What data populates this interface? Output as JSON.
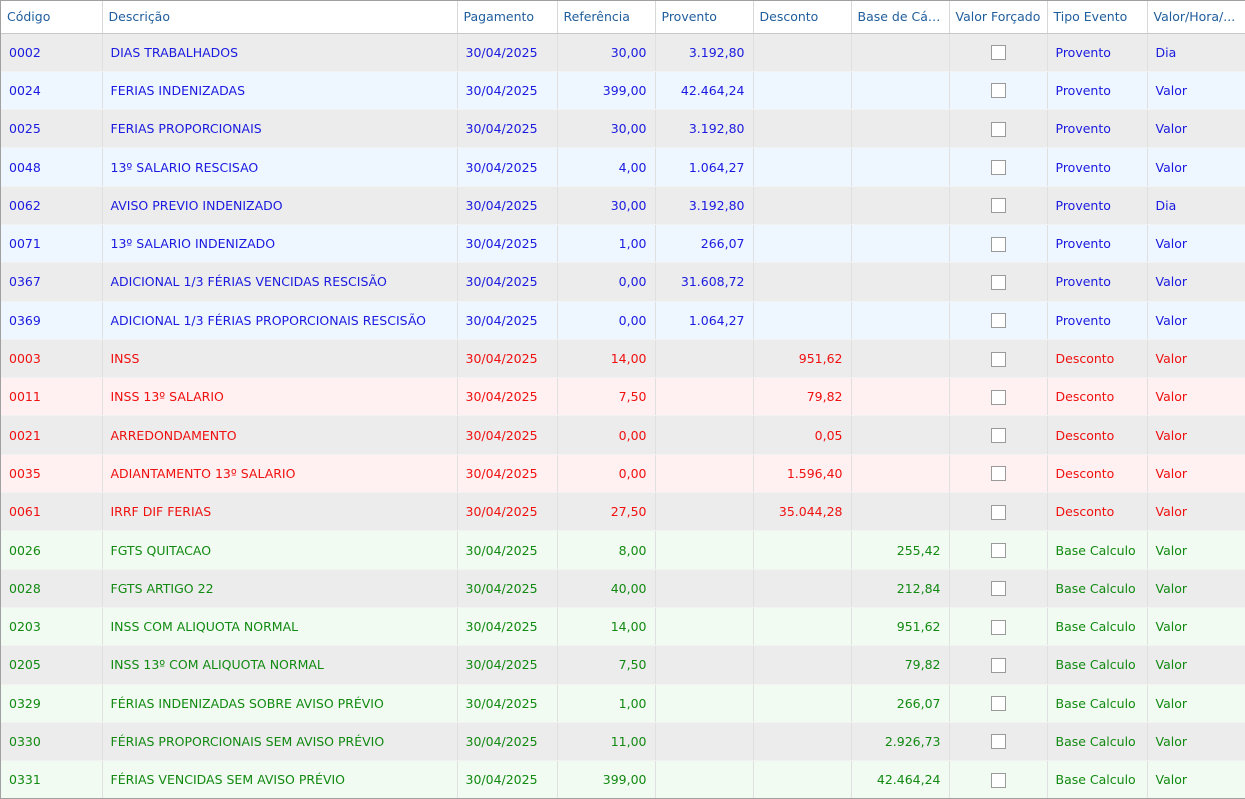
{
  "columns": {
    "codigo": "Código",
    "descricao": "Descrição",
    "pagamento": "Pagamento",
    "referencia": "Referência",
    "provento": "Provento",
    "desconto": "Desconto",
    "base": "Base de Cálc...",
    "forcado": "Valor Forçado",
    "tipo": "Tipo Evento",
    "vhd": "Valor/Hora/..."
  },
  "rows": [
    {
      "codigo": "0002",
      "descricao": "DIAS TRABALHADOS",
      "pagamento": "30/04/2025",
      "referencia": "30,00",
      "provento": "3.192,80",
      "desconto": "",
      "base": "",
      "forcado": false,
      "tipo": "Provento",
      "vhd": "Dia"
    },
    {
      "codigo": "0024",
      "descricao": "FERIAS INDENIZADAS",
      "pagamento": "30/04/2025",
      "referencia": "399,00",
      "provento": "42.464,24",
      "desconto": "",
      "base": "",
      "forcado": false,
      "tipo": "Provento",
      "vhd": "Valor"
    },
    {
      "codigo": "0025",
      "descricao": "FERIAS PROPORCIONAIS",
      "pagamento": "30/04/2025",
      "referencia": "30,00",
      "provento": "3.192,80",
      "desconto": "",
      "base": "",
      "forcado": false,
      "tipo": "Provento",
      "vhd": "Valor"
    },
    {
      "codigo": "0048",
      "descricao": "13º SALARIO RESCISAO",
      "pagamento": "30/04/2025",
      "referencia": "4,00",
      "provento": "1.064,27",
      "desconto": "",
      "base": "",
      "forcado": false,
      "tipo": "Provento",
      "vhd": "Valor"
    },
    {
      "codigo": "0062",
      "descricao": "AVISO PREVIO INDENIZADO",
      "pagamento": "30/04/2025",
      "referencia": "30,00",
      "provento": "3.192,80",
      "desconto": "",
      "base": "",
      "forcado": false,
      "tipo": "Provento",
      "vhd": "Dia"
    },
    {
      "codigo": "0071",
      "descricao": "13º SALARIO INDENIZADO",
      "pagamento": "30/04/2025",
      "referencia": "1,00",
      "provento": "266,07",
      "desconto": "",
      "base": "",
      "forcado": false,
      "tipo": "Provento",
      "vhd": "Valor"
    },
    {
      "codigo": "0367",
      "descricao": "ADICIONAL 1/3 FÉRIAS VENCIDAS RESCISÃO",
      "pagamento": "30/04/2025",
      "referencia": "0,00",
      "provento": "31.608,72",
      "desconto": "",
      "base": "",
      "forcado": false,
      "tipo": "Provento",
      "vhd": "Valor"
    },
    {
      "codigo": "0369",
      "descricao": "ADICIONAL 1/3 FÉRIAS PROPORCIONAIS RESCISÃO",
      "pagamento": "30/04/2025",
      "referencia": "0,00",
      "provento": "1.064,27",
      "desconto": "",
      "base": "",
      "forcado": false,
      "tipo": "Provento",
      "vhd": "Valor"
    },
    {
      "codigo": "0003",
      "descricao": "INSS",
      "pagamento": "30/04/2025",
      "referencia": "14,00",
      "provento": "",
      "desconto": "951,62",
      "base": "",
      "forcado": false,
      "tipo": "Desconto",
      "vhd": "Valor"
    },
    {
      "codigo": "0011",
      "descricao": "INSS 13º SALARIO",
      "pagamento": "30/04/2025",
      "referencia": "7,50",
      "provento": "",
      "desconto": "79,82",
      "base": "",
      "forcado": false,
      "tipo": "Desconto",
      "vhd": "Valor"
    },
    {
      "codigo": "0021",
      "descricao": "ARREDONDAMENTO",
      "pagamento": "30/04/2025",
      "referencia": "0,00",
      "provento": "",
      "desconto": "0,05",
      "base": "",
      "forcado": false,
      "tipo": "Desconto",
      "vhd": "Valor"
    },
    {
      "codigo": "0035",
      "descricao": "ADIANTAMENTO 13º SALARIO",
      "pagamento": "30/04/2025",
      "referencia": "0,00",
      "provento": "",
      "desconto": "1.596,40",
      "base": "",
      "forcado": false,
      "tipo": "Desconto",
      "vhd": "Valor"
    },
    {
      "codigo": "0061",
      "descricao": "IRRF DIF FERIAS",
      "pagamento": "30/04/2025",
      "referencia": "27,50",
      "provento": "",
      "desconto": "35.044,28",
      "base": "",
      "forcado": false,
      "tipo": "Desconto",
      "vhd": "Valor"
    },
    {
      "codigo": "0026",
      "descricao": "FGTS QUITACAO",
      "pagamento": "30/04/2025",
      "referencia": "8,00",
      "provento": "",
      "desconto": "",
      "base": "255,42",
      "forcado": false,
      "tipo": "Base Calculo",
      "vhd": "Valor"
    },
    {
      "codigo": "0028",
      "descricao": "FGTS ARTIGO 22",
      "pagamento": "30/04/2025",
      "referencia": "40,00",
      "provento": "",
      "desconto": "",
      "base": "212,84",
      "forcado": false,
      "tipo": "Base Calculo",
      "vhd": "Valor"
    },
    {
      "codigo": "0203",
      "descricao": "INSS COM ALIQUOTA NORMAL",
      "pagamento": "30/04/2025",
      "referencia": "14,00",
      "provento": "",
      "desconto": "",
      "base": "951,62",
      "forcado": false,
      "tipo": "Base Calculo",
      "vhd": "Valor"
    },
    {
      "codigo": "0205",
      "descricao": "INSS 13º COM ALIQUOTA NORMAL",
      "pagamento": "30/04/2025",
      "referencia": "7,50",
      "provento": "",
      "desconto": "",
      "base": "79,82",
      "forcado": false,
      "tipo": "Base Calculo",
      "vhd": "Valor"
    },
    {
      "codigo": "0329",
      "descricao": "FÉRIAS INDENIZADAS SOBRE AVISO PRÉVIO",
      "pagamento": "30/04/2025",
      "referencia": "1,00",
      "provento": "",
      "desconto": "",
      "base": "266,07",
      "forcado": false,
      "tipo": "Base Calculo",
      "vhd": "Valor"
    },
    {
      "codigo": "0330",
      "descricao": "FÉRIAS PROPORCIONAIS SEM AVISO PRÉVIO",
      "pagamento": "30/04/2025",
      "referencia": "11,00",
      "provento": "",
      "desconto": "",
      "base": "2.926,73",
      "forcado": false,
      "tipo": "Base Calculo",
      "vhd": "Valor"
    },
    {
      "codigo": "0331",
      "descricao": "FÉRIAS VENCIDAS SEM AVISO PRÉVIO",
      "pagamento": "30/04/2025",
      "referencia": "399,00",
      "provento": "",
      "desconto": "",
      "base": "42.464,24",
      "forcado": false,
      "tipo": "Base Calculo",
      "vhd": "Valor"
    }
  ],
  "colors": {
    "provento_text": "#1a1ae0",
    "desconto_text": "#f01010",
    "base_text": "#128a12",
    "header_text": "#1f5d9c"
  }
}
